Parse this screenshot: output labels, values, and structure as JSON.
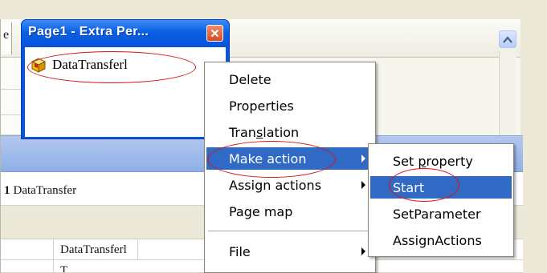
{
  "background_window": {
    "tab_fragment": "e",
    "property_row": {
      "number": "1",
      "name": "DataTransfer"
    },
    "grid_rows": [
      {
        "value": "DataTransferl"
      },
      {
        "value": "T..."
      }
    ]
  },
  "popup": {
    "title": "Page1 - Extra Per...",
    "item_label": "DataTransferl"
  },
  "context_menu": {
    "items": [
      {
        "label": "Delete"
      },
      {
        "label": "Properties"
      },
      {
        "label_pre": "Tran",
        "label_ul": "s",
        "label_post": "lation"
      },
      {
        "label": "Make action"
      },
      {
        "label": "Assign actions"
      },
      {
        "label": "Page map"
      },
      {
        "label": "File"
      }
    ]
  },
  "submenu": {
    "items": [
      {
        "label_pre": "Set ",
        "label_ul": "p",
        "label_post": "roperty"
      },
      {
        "label": "Start"
      },
      {
        "label": "SetParameter"
      },
      {
        "label": "AssignActions"
      }
    ]
  },
  "colors": {
    "menu_highlight": "#316ac5",
    "title_bar": "#0a5fe3",
    "annotation": "#d81414"
  }
}
